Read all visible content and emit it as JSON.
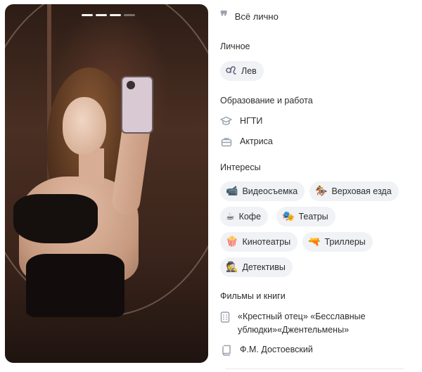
{
  "photo": {
    "indicator_count": 4,
    "active_index": 3
  },
  "about": {
    "title": "Всё лично"
  },
  "personal": {
    "title": "Личное",
    "zodiac": {
      "icon": "leo-icon",
      "label": "Лев"
    }
  },
  "education": {
    "title": "Образование и работа",
    "items": [
      {
        "icon": "graduation-cap-icon",
        "label": "НГТИ"
      },
      {
        "icon": "briefcase-icon",
        "label": "Актриса"
      }
    ]
  },
  "interests": {
    "title": "Интересы",
    "items": [
      {
        "emoji": "📹",
        "label": "Видеосъемка"
      },
      {
        "emoji": "🏇",
        "label": "Верховая езда"
      },
      {
        "emoji": "☕",
        "label": "Кофе"
      },
      {
        "emoji": "🎭",
        "label": "Театры"
      },
      {
        "emoji": "🍿",
        "label": "Кинотеатры"
      },
      {
        "emoji": "🔫",
        "label": "Триллеры"
      },
      {
        "emoji": "🕵",
        "label": "Детективы"
      }
    ]
  },
  "films_books": {
    "title": "Фильмы и книги",
    "items": [
      {
        "icon": "film-icon",
        "text": "«Крестный отец» «Бесславные ублюдки»«Джентельмены»"
      },
      {
        "icon": "book-icon",
        "text": "Ф.М. Достоевский"
      }
    ]
  }
}
